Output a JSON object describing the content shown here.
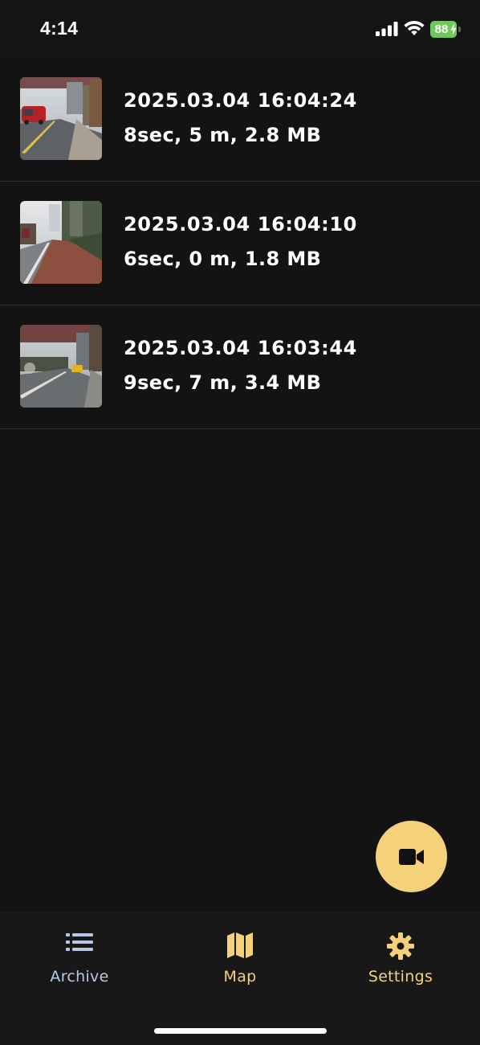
{
  "status_bar": {
    "time": "4:14",
    "battery_level": "88",
    "battery_color": "#6ec85a",
    "signal_bars": 4,
    "icons": [
      "cellular-signal-icon",
      "wifi-icon",
      "battery-charging-icon"
    ]
  },
  "recordings": [
    {
      "datetime": "2025.03.04 16:04:24",
      "details": "8sec, 5 m, 2.8 MB",
      "thumbnail": "dashcam-video-thumbnail"
    },
    {
      "datetime": "2025.03.04 16:04:10",
      "details": "6sec, 0 m, 1.8 MB",
      "thumbnail": "dashcam-video-thumbnail"
    },
    {
      "datetime": "2025.03.04 16:03:44",
      "details": "9sec, 7 m, 3.4 MB",
      "thumbnail": "dashcam-video-thumbnail"
    }
  ],
  "fab": {
    "icon": "video-camera-icon",
    "color": "#f6d17c"
  },
  "bottom_nav": {
    "items": [
      {
        "label": "Archive",
        "icon": "list-icon",
        "color": "#b9c8e6"
      },
      {
        "label": "Map",
        "icon": "map-icon",
        "color": "#f6d17c"
      },
      {
        "label": "Settings",
        "icon": "gear-icon",
        "color": "#f6d17c"
      }
    ]
  },
  "colors": {
    "background": "#131313",
    "divider": "#2c2c2c",
    "accent": "#f6d17c",
    "inactive_nav": "#b9c8e6"
  }
}
